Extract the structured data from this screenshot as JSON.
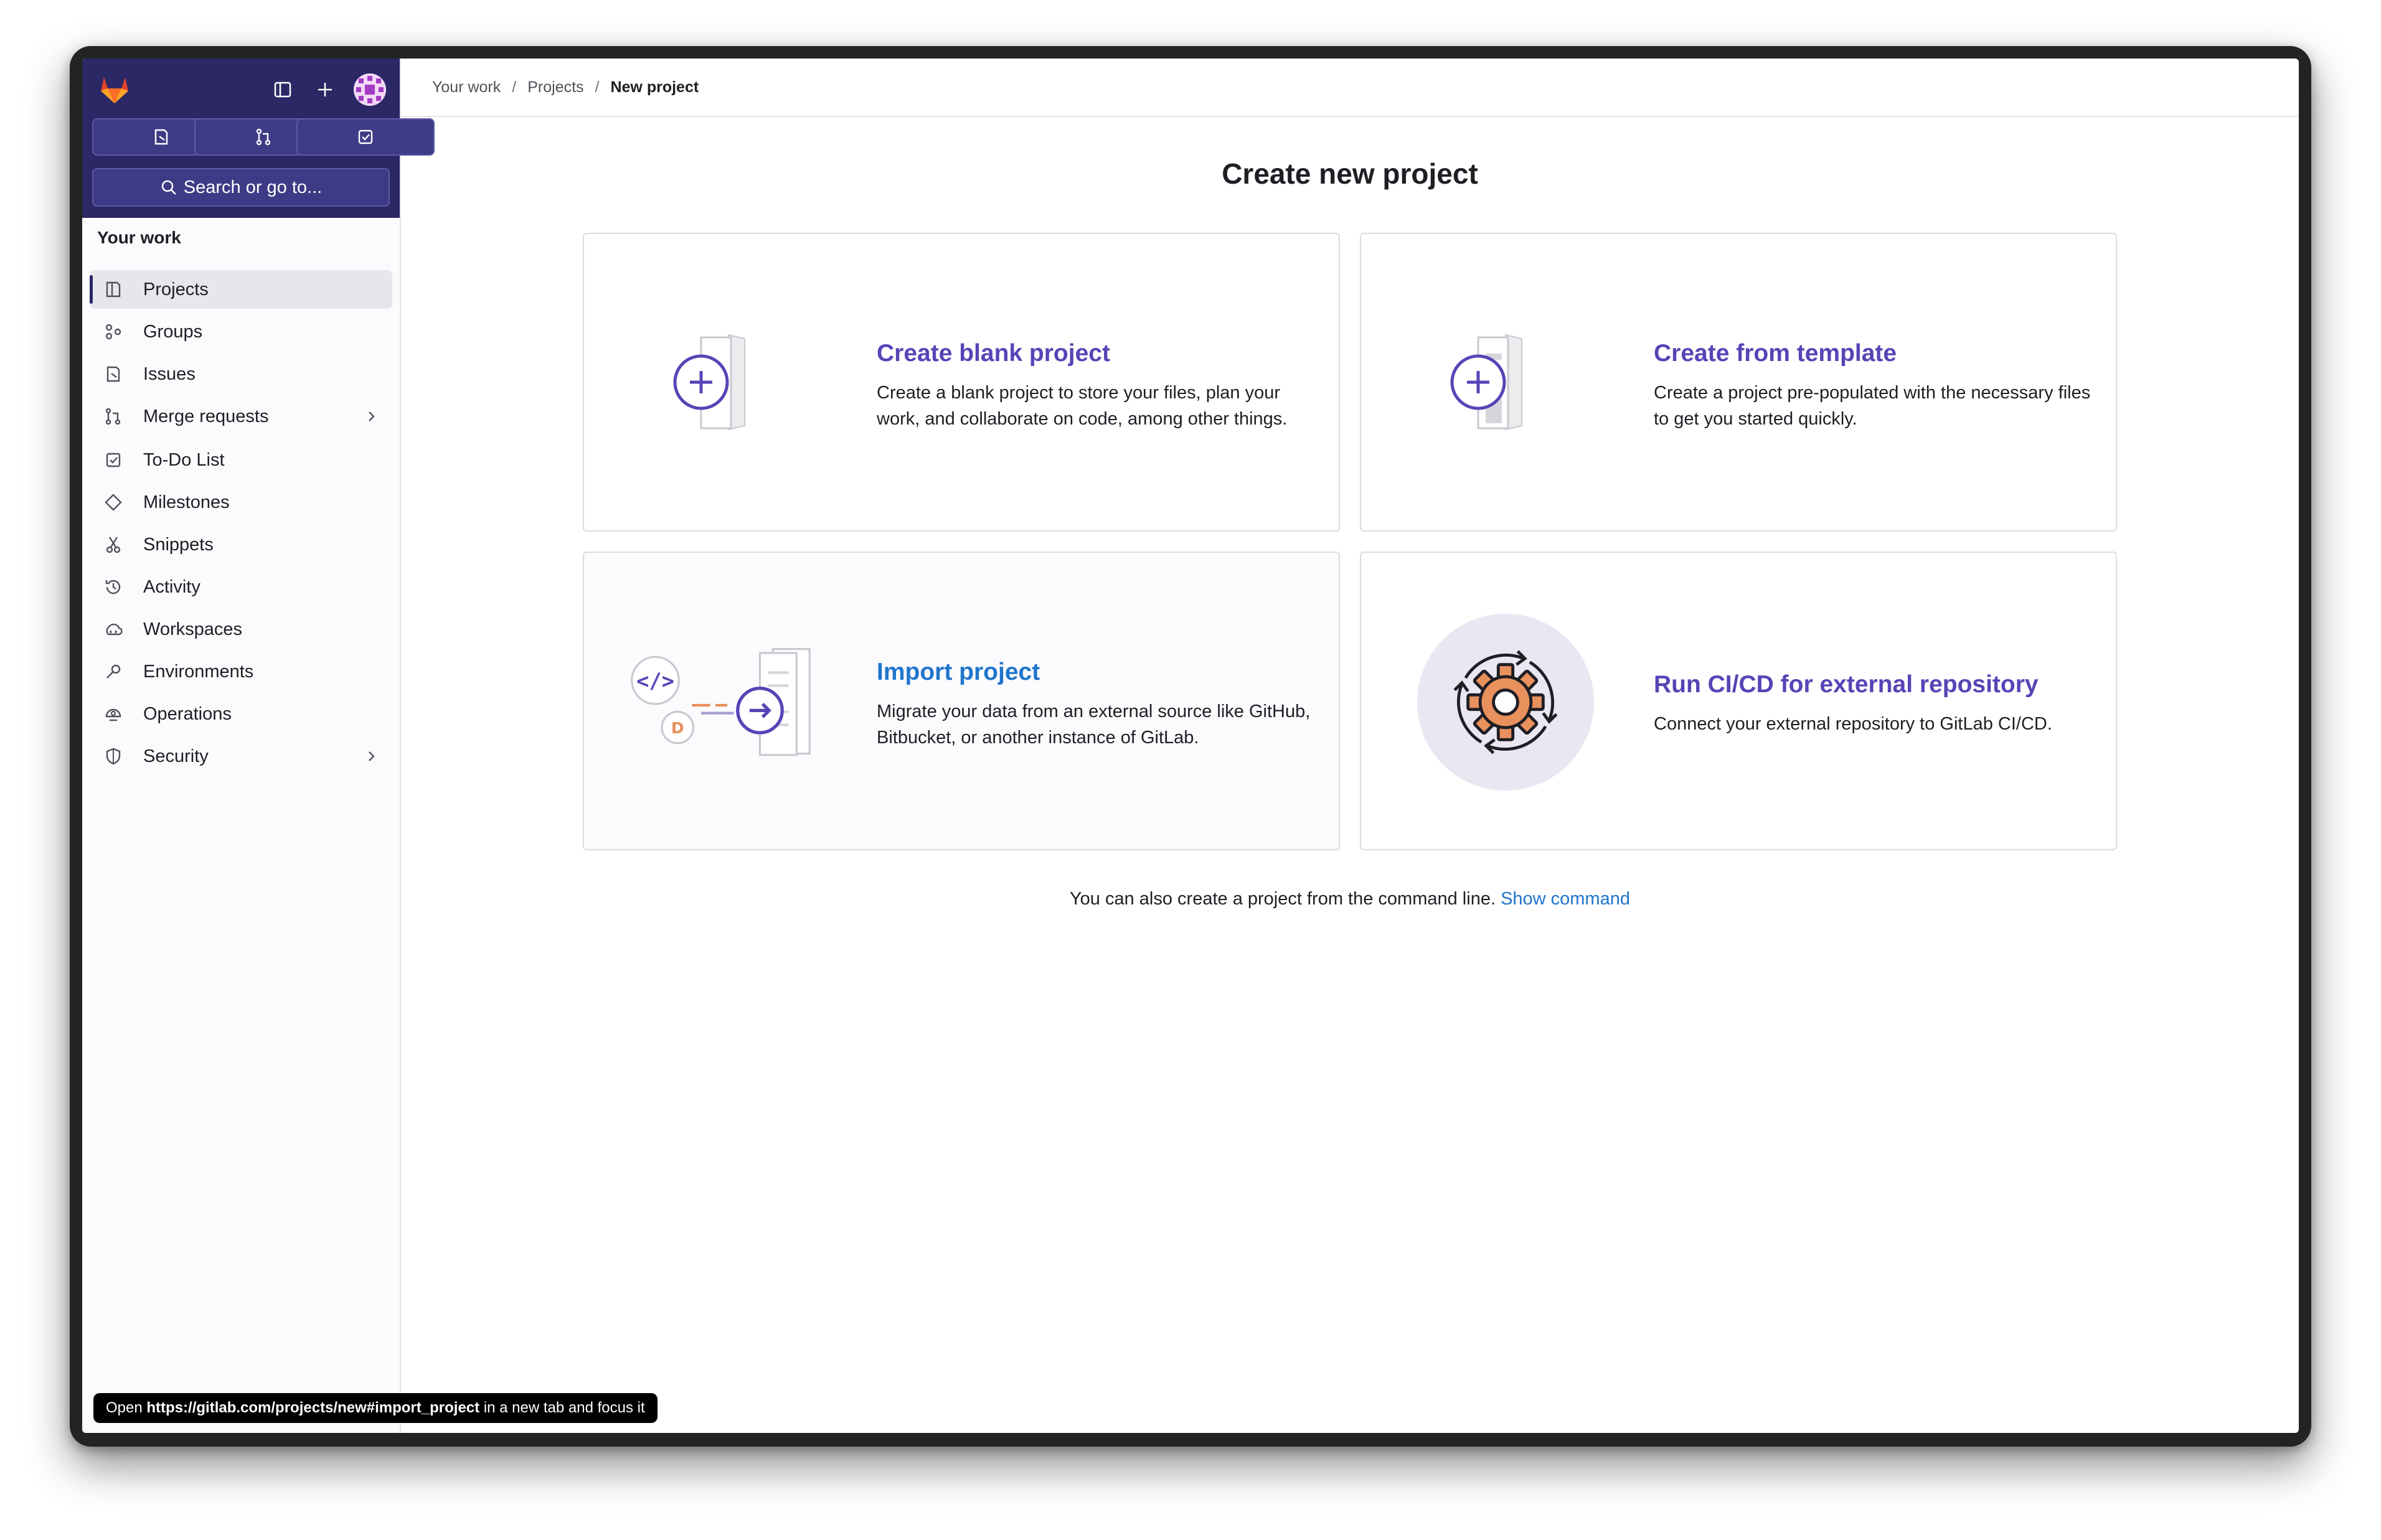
{
  "sidebar": {
    "search_label": "Search or go to...",
    "section_title": "Your work",
    "items": [
      {
        "label": "Projects",
        "icon": "project-icon"
      },
      {
        "label": "Groups",
        "icon": "group-icon"
      },
      {
        "label": "Issues",
        "icon": "issues-icon"
      },
      {
        "label": "Merge requests",
        "icon": "merge-request-icon"
      },
      {
        "label": "To-Do List",
        "icon": "todo-icon"
      },
      {
        "label": "Milestones",
        "icon": "milestone-icon"
      },
      {
        "label": "Snippets",
        "icon": "snippet-icon"
      },
      {
        "label": "Activity",
        "icon": "history-icon"
      },
      {
        "label": "Workspaces",
        "icon": "workspace-icon"
      },
      {
        "label": "Environments",
        "icon": "environment-icon"
      },
      {
        "label": "Operations",
        "icon": "operations-icon"
      },
      {
        "label": "Security",
        "icon": "shield-icon"
      }
    ]
  },
  "breadcrumb": {
    "items": [
      "Your work",
      "Projects"
    ],
    "current": "New project",
    "separator": "/"
  },
  "main": {
    "title": "Create new project",
    "cards": [
      {
        "title": "Create blank project",
        "description": "Create a blank project to store your files, plan your work, and collaborate on code, among other things."
      },
      {
        "title": "Create from template",
        "description": "Create a project pre-populated with the necessary files to get you started quickly."
      },
      {
        "title": "Import project",
        "description": "Migrate your data from an external source like GitHub, Bitbucket, or another instance of GitLab."
      },
      {
        "title": "Run CI/CD for external repository",
        "description": "Connect your external repository to GitLab CI/CD."
      }
    ],
    "cmdline_text": "You can also create a project from the command line.",
    "cmdline_link": "Show command"
  },
  "statusbar": {
    "prefix": "Open",
    "url": "https://gitlab.com/projects/new#import_project",
    "suffix": "in a new tab and focus it"
  },
  "colors": {
    "sidebar_top": "#2b2865",
    "card_title": "#5943b6",
    "link": "#1f75cb",
    "accent_orange": "#e9915d"
  }
}
